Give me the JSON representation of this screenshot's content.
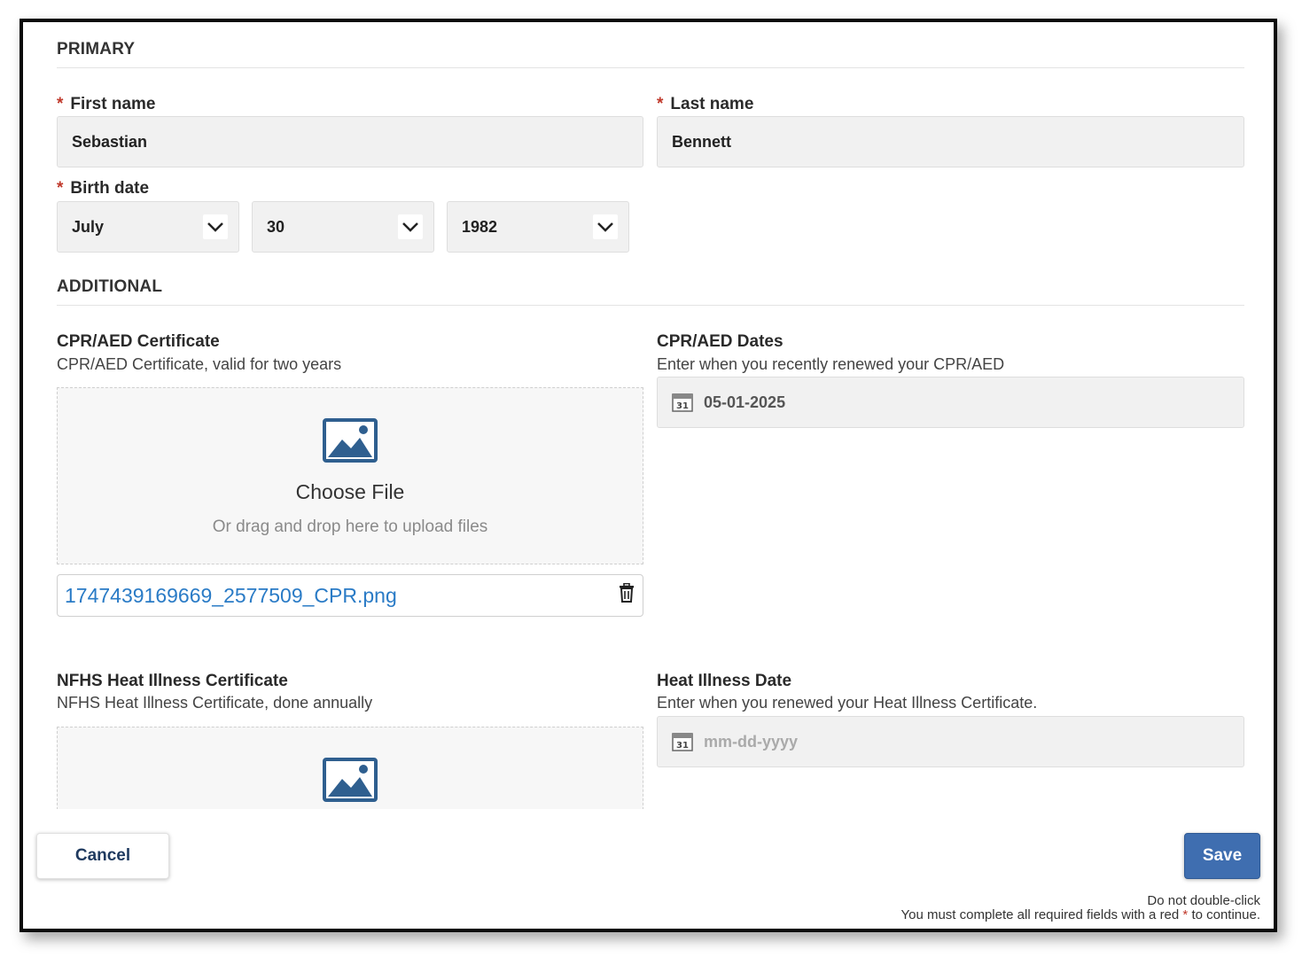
{
  "primary": {
    "title": "PRIMARY",
    "first_name": {
      "label": "First name",
      "value": "Sebastian"
    },
    "last_name": {
      "label": "Last name",
      "value": "Bennett"
    },
    "birth_date": {
      "label": "Birth date",
      "month": "July",
      "day": "30",
      "year": "1982"
    },
    "required_mark": "*"
  },
  "additional": {
    "title": "ADDITIONAL",
    "cpr_certificate": {
      "label": "CPR/AED Certificate",
      "description": "CPR/AED Certificate, valid for two years",
      "choose_file": "Choose File",
      "drag_hint": "Or drag and drop here to upload files",
      "uploaded_file": "1747439169669_2577509_CPR.png"
    },
    "cpr_dates": {
      "label": "CPR/AED Dates",
      "description": "Enter when you recently renewed your CPR/AED",
      "value": "05-01-2025",
      "calendar_day": "31"
    },
    "heat_certificate": {
      "label": "NFHS Heat Illness Certificate",
      "description": "NFHS Heat Illness Certificate, done annually"
    },
    "heat_date": {
      "label": "Heat Illness Date",
      "description": "Enter when you renewed your Heat Illness Certificate.",
      "placeholder": "mm-dd-yyyy",
      "calendar_day": "31"
    }
  },
  "footer": {
    "cancel_label": "Cancel",
    "save_label": "Save",
    "note_line1": "Do not double-click",
    "note_line2_pre": "You must complete all required fields with a red",
    "note_line2_mark": "*",
    "note_line2_post": "to continue."
  },
  "colors": {
    "accent": "#3f6eb0",
    "link": "#2a7bc6",
    "required": "#c0392b",
    "image_icon": "#2f5f8f"
  },
  "icons": [
    "chevron-down-icon",
    "calendar-icon",
    "image-icon",
    "trash-icon"
  ]
}
